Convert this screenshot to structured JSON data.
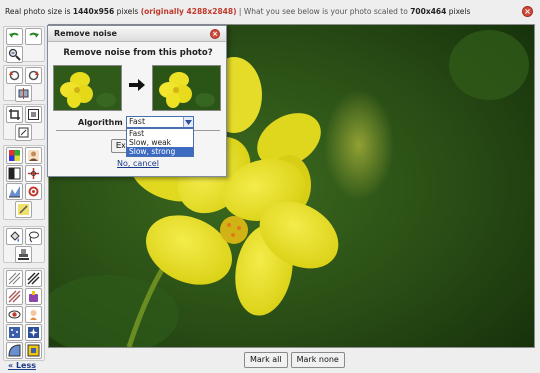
{
  "infobar": {
    "prefix": "Real photo size is ",
    "real_size": "1440x956",
    "pixels_word": " pixels ",
    "original": "(originally 4288x2848)",
    "middle": " | What you see below is your photo scaled to ",
    "scaled_size": "700x464",
    "suffix": " pixels"
  },
  "dialog": {
    "title": "Remove noise",
    "heading": "Remove noise from this photo?",
    "algorithm_label": "Algorithm",
    "selected": "Fast",
    "options": [
      "Fast",
      "Slow, weak",
      "Slow, strong"
    ],
    "highlighted_option": "Slow, strong",
    "execute_label": "Ex",
    "cancel_label": "No, cancel"
  },
  "buttons": {
    "mark_all": "Mark all",
    "mark_none": "Mark none"
  },
  "less_link": "« Less",
  "colors": {
    "accent_red": "#d24b3a",
    "select_blue": "#3e6bc2",
    "link_blue": "#1a3a8a",
    "background": "#eeeeee"
  },
  "toolbar_icons": [
    "undo-icon",
    "redo-icon",
    "zoom-icon",
    "rotate-left-icon",
    "rotate-right-icon",
    "flip-icon",
    "crop-icon",
    "resize-icon",
    "straighten-icon",
    "color-palette-icon",
    "portrait-icon",
    "contrast-icon",
    "sharpen-icon",
    "levels-icon",
    "target-icon",
    "pencil-icon",
    "paint-bucket-icon",
    "lasso-icon",
    "clone-stamp-icon",
    "hatch-light-icon",
    "hatch-dark-icon",
    "gradient-icon",
    "brush-icon",
    "red-eye-icon",
    "light-icon",
    "noise-icon",
    "sparkle-icon",
    "frame-icon",
    "text-icon"
  ]
}
